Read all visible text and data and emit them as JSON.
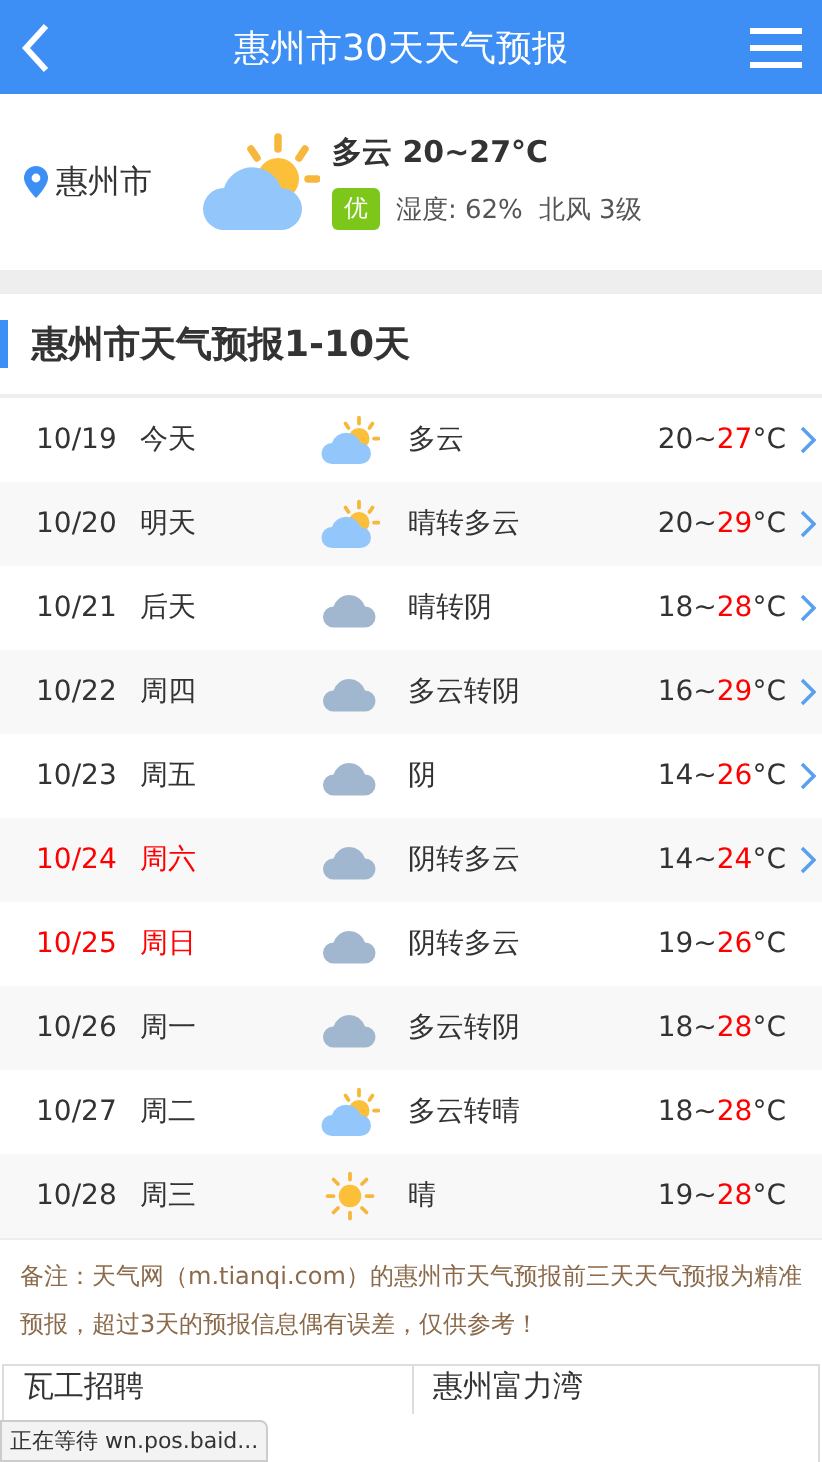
{
  "header": {
    "title": "惠州市30天天气预报"
  },
  "current": {
    "city": "惠州市",
    "kind": "cloud-sun",
    "summary": "多云 20~27°C",
    "aqi": "优",
    "humidity": "湿度: 62%",
    "wind": "北风 3级"
  },
  "section_title": "惠州市天气预报1-10天",
  "days": [
    {
      "date": "10/19",
      "day": "今天",
      "kind": "cloud-sun",
      "weather": "多云",
      "low": "20~",
      "high": "27",
      "unit": "°C",
      "weekend": false,
      "link": true
    },
    {
      "date": "10/20",
      "day": "明天",
      "kind": "cloud-sun",
      "weather": "晴转多云",
      "low": "20~",
      "high": "29",
      "unit": "°C",
      "weekend": false,
      "link": true
    },
    {
      "date": "10/21",
      "day": "后天",
      "kind": "cloud",
      "weather": "晴转阴",
      "low": "18~",
      "high": "28",
      "unit": "°C",
      "weekend": false,
      "link": true
    },
    {
      "date": "10/22",
      "day": "周四",
      "kind": "cloud",
      "weather": "多云转阴",
      "low": "16~",
      "high": "29",
      "unit": "°C",
      "weekend": false,
      "link": true
    },
    {
      "date": "10/23",
      "day": "周五",
      "kind": "cloud",
      "weather": "阴",
      "low": "14~",
      "high": "26",
      "unit": "°C",
      "weekend": false,
      "link": true
    },
    {
      "date": "10/24",
      "day": "周六",
      "kind": "cloud",
      "weather": "阴转多云",
      "low": "14~",
      "high": "24",
      "unit": "°C",
      "weekend": true,
      "link": true
    },
    {
      "date": "10/25",
      "day": "周日",
      "kind": "cloud",
      "weather": "阴转多云",
      "low": "19~",
      "high": "26",
      "unit": "°C",
      "weekend": true,
      "link": false
    },
    {
      "date": "10/26",
      "day": "周一",
      "kind": "cloud",
      "weather": "多云转阴",
      "low": "18~",
      "high": "28",
      "unit": "°C",
      "weekend": false,
      "link": false
    },
    {
      "date": "10/27",
      "day": "周二",
      "kind": "cloud-sun",
      "weather": "多云转晴",
      "low": "18~",
      "high": "28",
      "unit": "°C",
      "weekend": false,
      "link": false
    },
    {
      "date": "10/28",
      "day": "周三",
      "kind": "sun",
      "weather": "晴",
      "low": "19~",
      "high": "28",
      "unit": "°C",
      "weekend": false,
      "link": false
    }
  ],
  "note": "备注：天气网（m.tianqi.com）的惠州市天气预报前三天天气预报为精准预报，超过3天的预报信息偶有误差，仅供参考！",
  "links": [
    "瓦工招聘",
    "惠州富力湾"
  ],
  "status_bar": "正在等待 wn.pos.baid..."
}
